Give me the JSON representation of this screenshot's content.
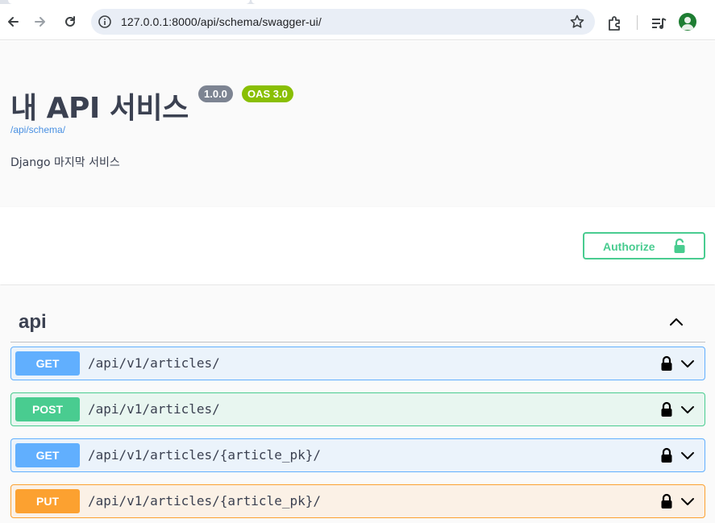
{
  "browser": {
    "url": "127.0.0.1:8000/api/schema/swagger-ui/",
    "icons": {
      "back": "arrow-left-icon",
      "forward": "arrow-right-icon",
      "reload": "reload-icon",
      "site_info": "info-icon",
      "bookmark": "star-icon",
      "extensions": "puzzle-icon",
      "media": "media-control-icon",
      "profile": "profile-avatar-icon"
    }
  },
  "info": {
    "title": "내 API 서비스",
    "version": "1.0.0",
    "oas": "OAS 3.0",
    "schema_link": "/api/schema/",
    "description": "Django 마지막 서비스"
  },
  "authorize": {
    "label": "Authorize",
    "color": "#49cc90"
  },
  "tag": {
    "name": "api"
  },
  "operations": [
    {
      "method": "GET",
      "path": "/api/v1/articles/",
      "color": "#61affe"
    },
    {
      "method": "POST",
      "path": "/api/v1/articles/",
      "color": "#49cc90"
    },
    {
      "method": "GET",
      "path": "/api/v1/articles/{article_pk}/",
      "color": "#61affe"
    },
    {
      "method": "PUT",
      "path": "/api/v1/articles/{article_pk}/",
      "color": "#fca130"
    }
  ]
}
